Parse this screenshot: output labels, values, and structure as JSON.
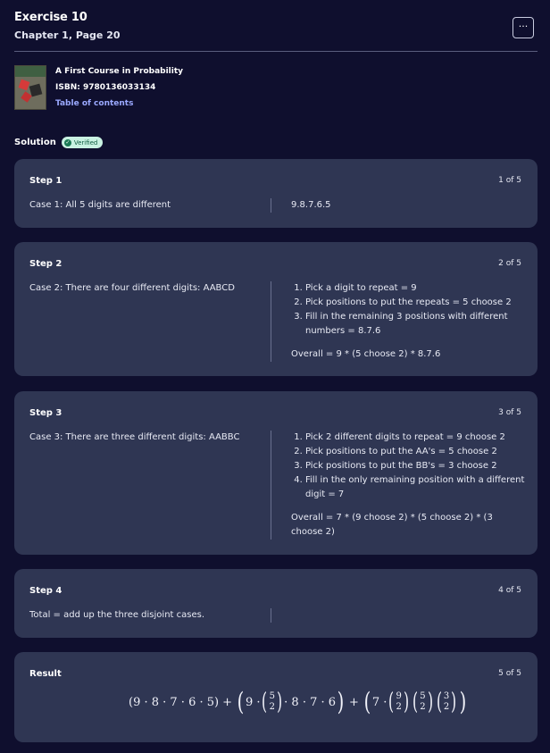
{
  "header": {
    "title": "Exercise 10",
    "subtitle": "Chapter 1, Page 20",
    "more_label": "···"
  },
  "book": {
    "title": "A First Course in Probability",
    "isbn": "ISBN: 9780136033134",
    "toc_label": "Table of contents"
  },
  "solution": {
    "label": "Solution",
    "badge": "Verified"
  },
  "steps": [
    {
      "label": "Step 1",
      "counter": "1 of 5",
      "left": "Case 1: All 5 digits are different",
      "right_text": "9.8.7.6.5"
    },
    {
      "label": "Step 2",
      "counter": "2 of 5",
      "left": "Case 2: There are four different digits: AABCD",
      "items": [
        "Pick a digit to repeat = 9",
        "Pick positions to put the repeats = 5 choose 2",
        "Fill in the remaining 3 positions with different numbers = 8.7.6"
      ],
      "overall": "Overall = 9 * (5 choose 2) * 8.7.6"
    },
    {
      "label": "Step 3",
      "counter": "3 of 5",
      "left": "Case 3: There are three different digits: AABBC",
      "items": [
        "Pick 2 different digits to repeat = 9 choose 2",
        "Pick positions to put the AA's = 5 choose 2",
        "Pick positions to put the BB's = 3 choose 2",
        "Fill in the only remaining position with a different digit = 7"
      ],
      "overall": "Overall = 7 * (9 choose 2) * (5 choose 2) * (3 choose 2)"
    },
    {
      "label": "Step 4",
      "counter": "4 of 5",
      "left": "Total = add up the three disjoint cases."
    }
  ],
  "result": {
    "label": "Result",
    "counter": "5 of 5",
    "formula": {
      "term1": "(9 · 8 · 7 · 6 · 5)",
      "plus": "+",
      "term2_prefix": "9 ·",
      "binom_5_2": [
        "5",
        "2"
      ],
      "term2_suffix": "· 8 · 7 · 6",
      "term3_prefix": "7 ·",
      "binom_9_2": [
        "9",
        "2"
      ],
      "binom_3_2": [
        "3",
        "2"
      ]
    }
  }
}
